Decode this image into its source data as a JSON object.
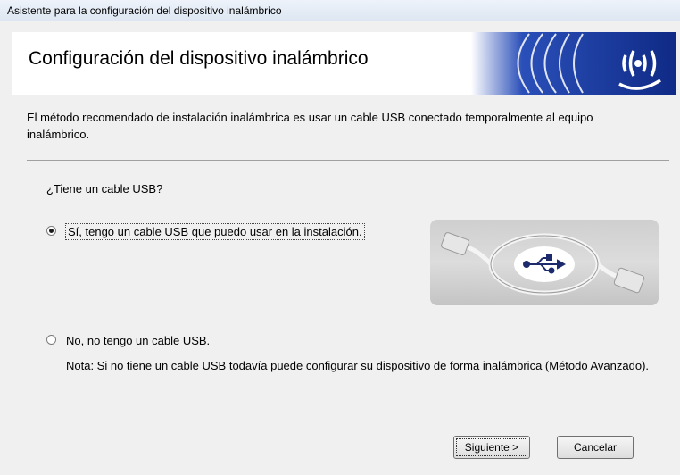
{
  "window": {
    "title": "Asistente para la configuración del dispositivo inalámbrico"
  },
  "header": {
    "title": "Configuración del dispositivo inalámbrico",
    "logo_icon": "wireless-wave-icon"
  },
  "intro_text": "El método recomendado de instalación inalámbrica es usar un cable USB conectado temporalmente al equipo inalámbrico.",
  "question": "¿Tiene un cable USB?",
  "options": [
    {
      "label": "Sí, tengo un cable USB que puedo usar en la instalación.",
      "checked": true
    },
    {
      "label": "No, no tengo un cable USB.",
      "checked": false
    }
  ],
  "note": "Nota: Si no tiene un cable USB todavía puede configurar su dispositivo de forma inalámbrica (Método Avanzado).",
  "usb_image_icon": "usb-cable-icon",
  "buttons": {
    "next": "Siguiente >",
    "cancel": "Cancelar"
  },
  "colors": {
    "header_accent": "#1b3fa0"
  }
}
